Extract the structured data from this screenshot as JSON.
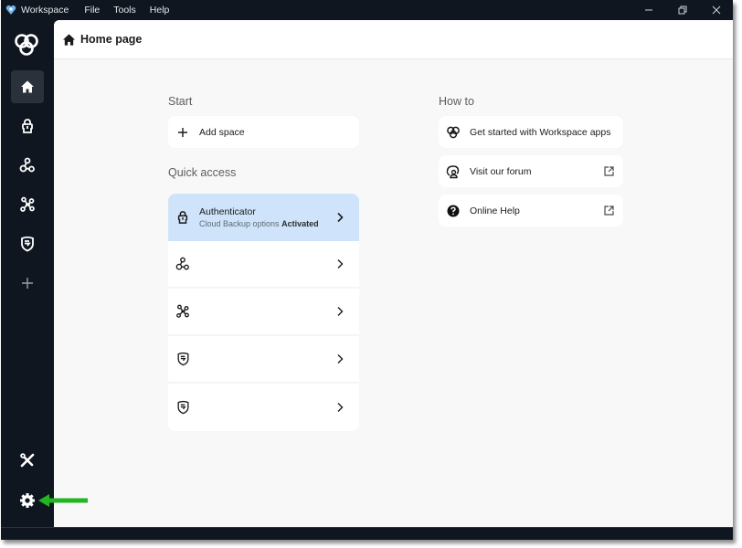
{
  "titlebar": {
    "app_name": "Workspace",
    "menu": [
      "File",
      "Tools",
      "Help"
    ],
    "controls": [
      "minimize-icon",
      "restore-icon",
      "close-icon"
    ]
  },
  "sidebar": {
    "logo": "workspace-logo-icon",
    "items": [
      {
        "name": "home",
        "icon": "home-icon",
        "active": true
      },
      {
        "name": "authenticator",
        "icon": "authenticator-icon",
        "active": false
      },
      {
        "name": "connections",
        "icon": "nodes-icon",
        "active": false
      },
      {
        "name": "network",
        "icon": "network-icon",
        "active": false
      },
      {
        "name": "shield",
        "icon": "shield-icon",
        "active": false
      },
      {
        "name": "add",
        "icon": "plus-icon",
        "active": false
      }
    ],
    "bottom_items": [
      {
        "name": "tools",
        "icon": "tools-icon"
      },
      {
        "name": "settings",
        "icon": "gear-icon"
      }
    ]
  },
  "header": {
    "icon": "home-icon",
    "title": "Home page"
  },
  "start": {
    "label": "Start",
    "add_space": "Add space"
  },
  "quick_access": {
    "label": "Quick access",
    "items": [
      {
        "icon": "authenticator-icon",
        "title": "Authenticator",
        "subtitle": "Cloud Backup options",
        "status": "Activated",
        "selected": true
      },
      {
        "icon": "nodes-icon",
        "title": "",
        "selected": false
      },
      {
        "icon": "network-icon",
        "title": "",
        "selected": false
      },
      {
        "icon": "shield-icon",
        "title": "",
        "selected": false
      },
      {
        "icon": "shield-icon",
        "title": "",
        "selected": false
      }
    ]
  },
  "how_to": {
    "label": "How to",
    "items": [
      {
        "icon": "workspace-logo-icon",
        "label": "Get started with Workspace apps",
        "external": false
      },
      {
        "icon": "forum-icon",
        "label": "Visit our forum",
        "external": true
      },
      {
        "icon": "help-icon",
        "label": "Online Help",
        "external": true
      }
    ]
  },
  "annotation": {
    "arrow_color": "#22b622",
    "points_to": "settings"
  },
  "colors": {
    "sidebar_bg": "#0f1620",
    "active_bg": "#2b313a",
    "selected_row": "#cfe4fa",
    "main_bg": "#f8f8f8"
  }
}
